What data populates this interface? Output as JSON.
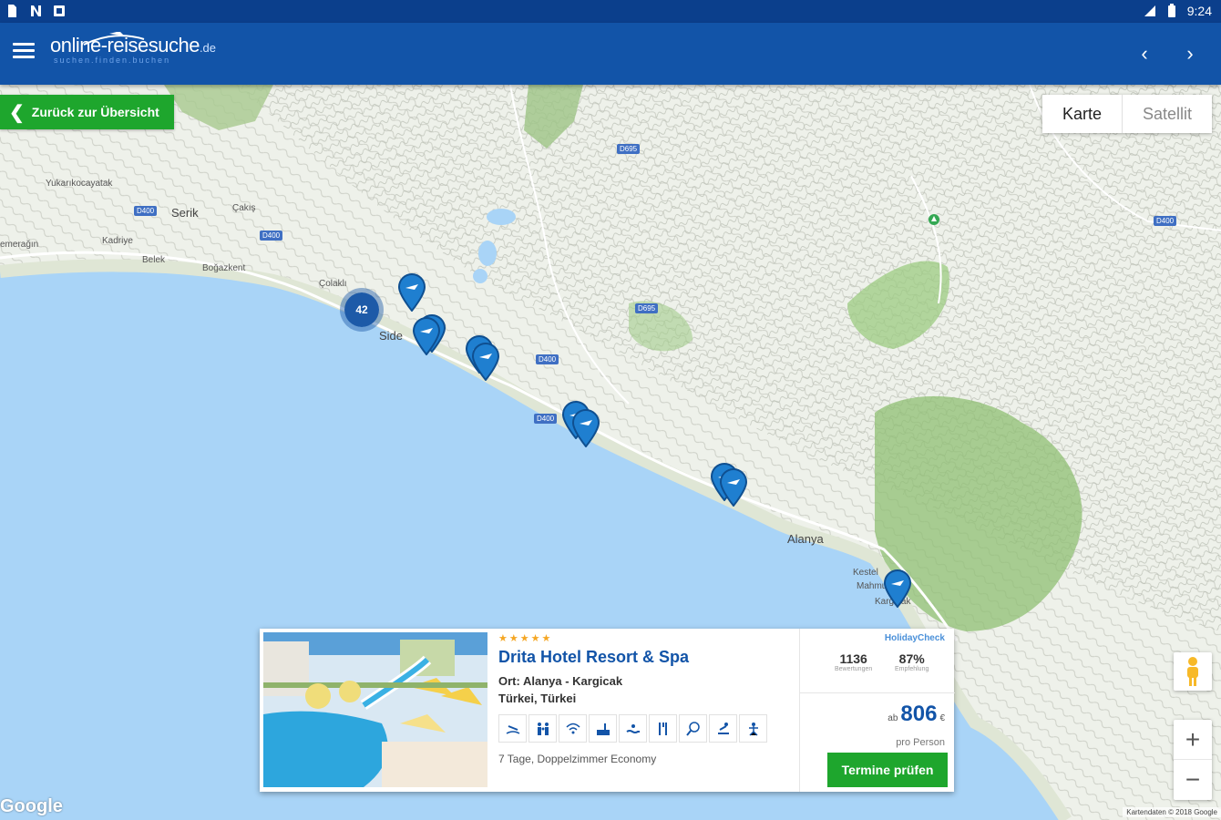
{
  "status_bar": {
    "time": "9:24"
  },
  "app_bar": {
    "logo_text": "online-reisesuche",
    "logo_tld": ".de",
    "logo_tagline": "suchen.finden.buchen"
  },
  "map": {
    "back_label": "Zurück zur Übersicht",
    "map_type": {
      "map_label": "Karte",
      "satellite_label": "Satellit"
    },
    "cluster_count": "42",
    "places": {
      "serik": "Serik",
      "side": "Side",
      "alanya": "Alanya",
      "yukarikocayatak": "Yukarıkocayatak",
      "kadriye": "Kadriye",
      "belek": "Belek",
      "bogazkent": "Boğazkent",
      "cakis": "Çakış",
      "colakli": "Çolaklı",
      "emeragin": "emerağın",
      "kargicak": "Kargıcak",
      "kestel": "Kestel",
      "mahmutlar": "Mahmutlar",
      "kargicak2": "Kargıcak"
    },
    "roads": {
      "d400": "D400",
      "d695": "D695"
    },
    "google": "Google",
    "attribution": "Kartendaten © 2018 Google"
  },
  "hotel_card": {
    "stars": "★★★★★",
    "name": "Drita Hotel Resort & Spa",
    "location": "Ort: Alanya - Kargicak",
    "country": "Türkei, Türkei",
    "offer": "7 Tage, Doppelzimmer Economy",
    "holidaycheck": {
      "brand": "HolidayCheck",
      "reviews": "1136",
      "reviews_label": "Bewertungen",
      "recommend": "87%",
      "recommend_label": "Empfehlung"
    },
    "price_prefix": "ab",
    "price": "806",
    "currency": "€",
    "per_person": "pro Person",
    "cta_label": "Termine prüfen",
    "amenities": [
      "beach-icon",
      "family-icon",
      "wifi-icon",
      "pool-icon",
      "indoor-pool-icon",
      "restaurant-icon",
      "tennis-icon",
      "spa-icon",
      "fitness-icon"
    ]
  },
  "colors": {
    "brand_blue": "#1254a8",
    "status_blue": "#0b3f8c",
    "cta_green": "#1ea62d",
    "sea": "#a9d4f7",
    "land": "#eef1ea"
  }
}
